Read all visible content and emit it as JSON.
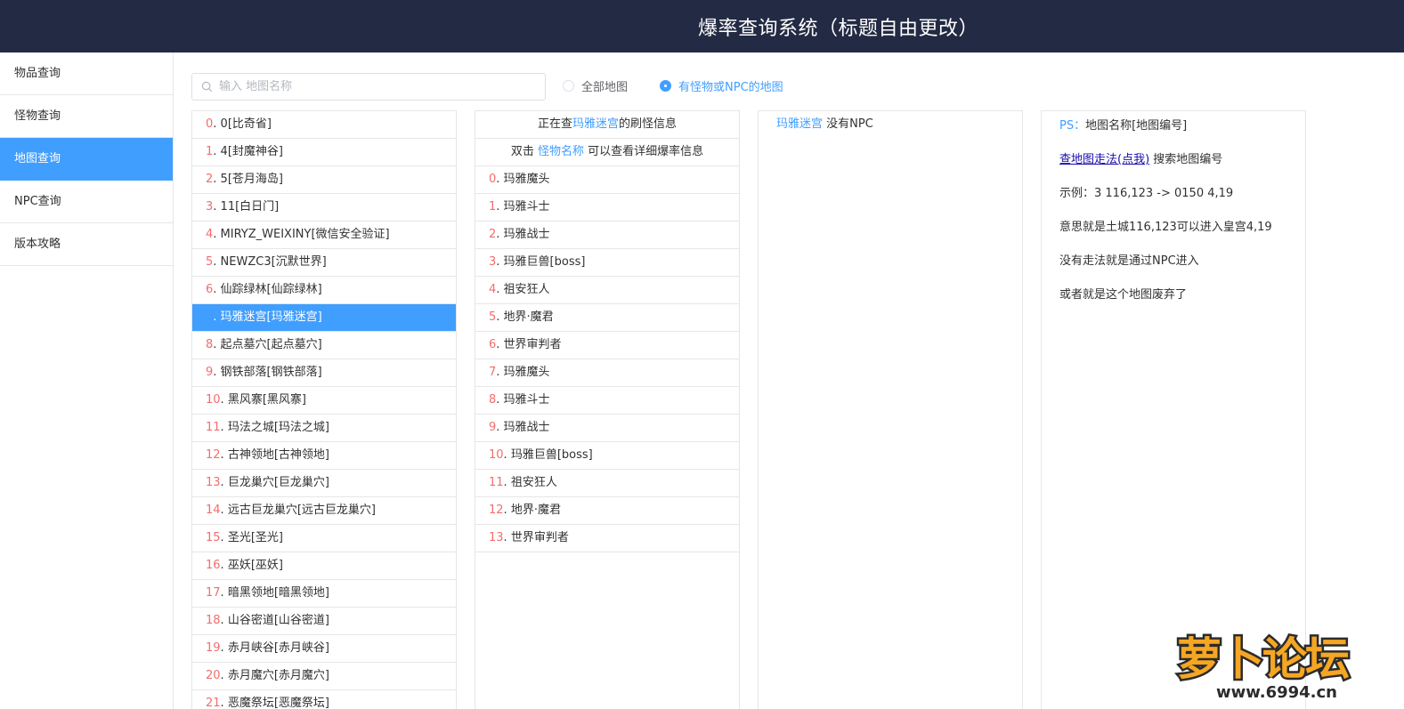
{
  "header": {
    "title": "爆率查询系统（标题自由更改）"
  },
  "sidebar": {
    "items": [
      {
        "label": "物品查询",
        "active": false
      },
      {
        "label": "怪物查询",
        "active": false
      },
      {
        "label": "地图查询",
        "active": true
      },
      {
        "label": "NPC查询",
        "active": false
      },
      {
        "label": "版本攻略",
        "active": false
      }
    ]
  },
  "search": {
    "placeholder": "输入 地图名称",
    "value": ""
  },
  "filters": {
    "all_maps": {
      "label": "全部地图",
      "checked": false
    },
    "with_monsters": {
      "label": "有怪物或NPC的地图",
      "checked": true
    }
  },
  "maps": {
    "selected_index": 7,
    "items": [
      {
        "index": "0",
        "name": "0[比奇省]"
      },
      {
        "index": "1",
        "name": "4[封魔神谷]"
      },
      {
        "index": "2",
        "name": "5[苍月海岛]"
      },
      {
        "index": "3",
        "name": "11[白日门]"
      },
      {
        "index": "4",
        "name": "MIRYZ_WEIXINY[微信安全验证]"
      },
      {
        "index": "5",
        "name": "NEWZC3[沉默世界]"
      },
      {
        "index": "6",
        "name": "仙踪绿林[仙踪绿林]"
      },
      {
        "index": "7",
        "name": "玛雅迷宫[玛雅迷宫]"
      },
      {
        "index": "8",
        "name": "起点墓穴[起点墓穴]"
      },
      {
        "index": "9",
        "name": "钢铁部落[钢铁部落]"
      },
      {
        "index": "10",
        "name": "黑风寨[黑风寨]"
      },
      {
        "index": "11",
        "name": "玛法之城[玛法之城]"
      },
      {
        "index": "12",
        "name": "古神领地[古神领地]"
      },
      {
        "index": "13",
        "name": "巨龙巢穴[巨龙巢穴]"
      },
      {
        "index": "14",
        "name": "远古巨龙巢穴[远古巨龙巢穴]"
      },
      {
        "index": "15",
        "name": "圣光[圣光]"
      },
      {
        "index": "16",
        "name": "巫妖[巫妖]"
      },
      {
        "index": "17",
        "name": "暗黑领地[暗黑领地]"
      },
      {
        "index": "18",
        "name": "山谷密道[山谷密道]"
      },
      {
        "index": "19",
        "name": "赤月峡谷[赤月峡谷]"
      },
      {
        "index": "20",
        "name": "赤月魔穴[赤月魔穴]"
      },
      {
        "index": "21",
        "name": "恶魔祭坛[恶魔祭坛]"
      }
    ]
  },
  "monsters": {
    "header_prefix": "正在查",
    "header_map": "玛雅迷宫",
    "header_suffix": "的刷怪信息",
    "hint_prefix": "双击",
    "hint_link": "怪物名称",
    "hint_suffix": "可以查看详细爆率信息",
    "items": [
      {
        "index": "0",
        "name": "玛雅魔头"
      },
      {
        "index": "1",
        "name": "玛雅斗士"
      },
      {
        "index": "2",
        "name": "玛雅战士"
      },
      {
        "index": "3",
        "name": "玛雅巨兽[boss]"
      },
      {
        "index": "4",
        "name": "祖安狂人"
      },
      {
        "index": "5",
        "name": "地界·魔君"
      },
      {
        "index": "6",
        "name": "世界审判者"
      },
      {
        "index": "7",
        "name": "玛雅魔头"
      },
      {
        "index": "8",
        "name": "玛雅斗士"
      },
      {
        "index": "9",
        "name": "玛雅战士"
      },
      {
        "index": "10",
        "name": "玛雅巨兽[boss]"
      },
      {
        "index": "11",
        "name": "祖安狂人"
      },
      {
        "index": "12",
        "name": "地界·魔君"
      },
      {
        "index": "13",
        "name": "世界审判者"
      }
    ]
  },
  "npc": {
    "map": "玛雅迷宫",
    "text": "没有NPC"
  },
  "info": {
    "ps_label": "PS：",
    "ps_text": "地图名称[地图编号]",
    "route_link": "查地图走法(点我)",
    "route_text": "搜索地图编号",
    "example": "示例：3 116,123 -> 0150 4,19",
    "meaning": "意思就是土城116,123可以进入皇宫4,19",
    "no_route": "没有走法就是通过NPC进入",
    "abandoned": "或者就是这个地图废弃了"
  },
  "watermark": {
    "logo_text": "萝卜论坛",
    "url": "www.6994.cn"
  },
  "colors": {
    "header_bg": "#232a43",
    "accent": "#409eff",
    "index_red": "#f56c6c"
  }
}
